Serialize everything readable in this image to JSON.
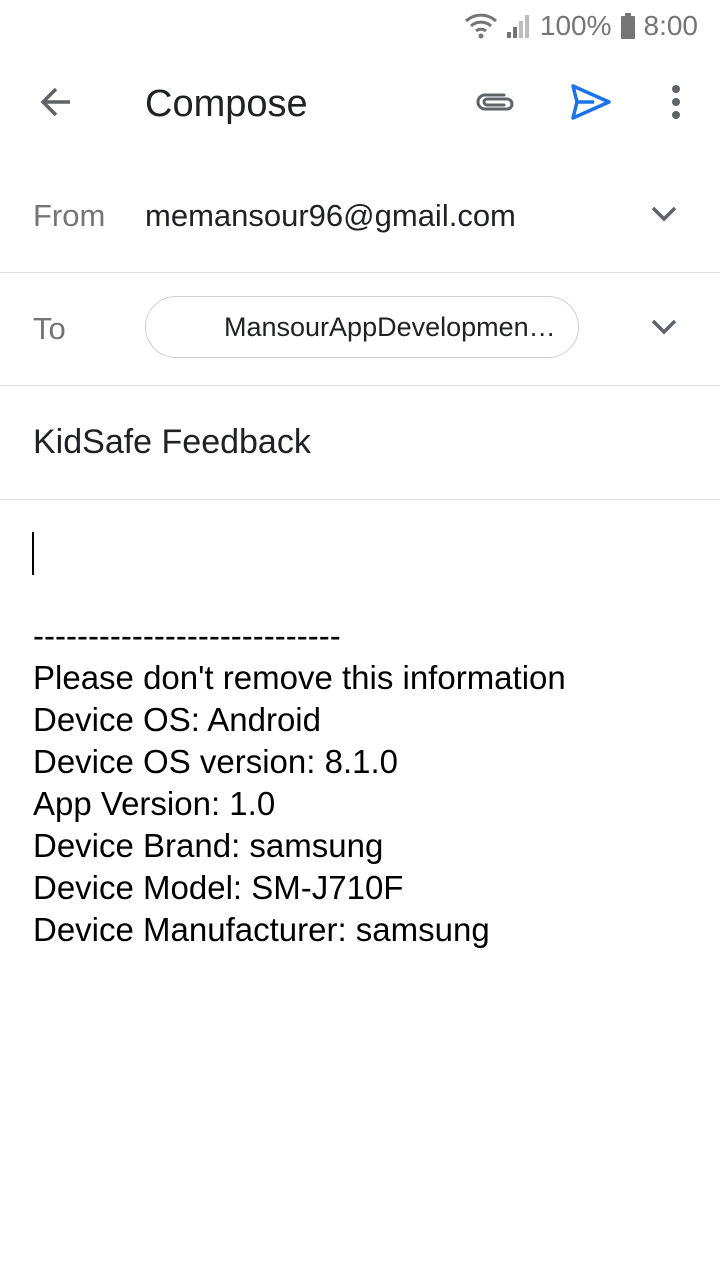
{
  "status_bar": {
    "battery_percent": "100%",
    "time": "8:00",
    "icons": [
      "wifi-icon",
      "signal-icon",
      "battery-icon"
    ]
  },
  "app_bar": {
    "title": "Compose",
    "icons": [
      "back-arrow-icon",
      "attachment-icon",
      "send-icon",
      "more-vert-icon"
    ],
    "send_color": "#1a73e8"
  },
  "from": {
    "label": "From",
    "value": "memansour96@gmail.com"
  },
  "to": {
    "label": "To",
    "recipient": "MansourAppDevelopmen…"
  },
  "subject": {
    "value": "KidSafe Feedback"
  },
  "body": {
    "lines": [
      "----------------------------",
      "Please don't remove this information",
      "Device OS: Android",
      "Device OS version: 8.1.0",
      "App Version: 1.0",
      "Device Brand: samsung",
      "Device Model: SM-J710F",
      "Device Manufacturer: samsung"
    ]
  }
}
